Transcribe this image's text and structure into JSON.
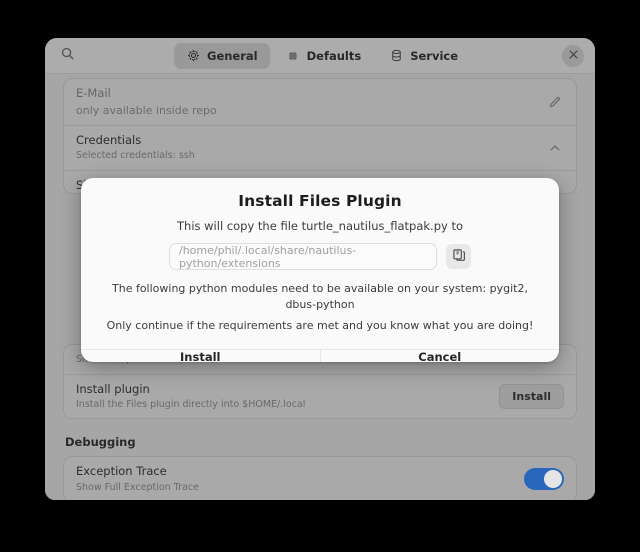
{
  "window": {
    "headerbar": {
      "search_icon": "search-icon",
      "close_icon": "close-icon",
      "tabs": [
        {
          "label": "General",
          "icon": "gear-icon",
          "active": true
        },
        {
          "label": "Defaults",
          "icon": "defaults-icon",
          "active": false
        },
        {
          "label": "Service",
          "icon": "database-icon",
          "active": false
        }
      ]
    },
    "settings": {
      "rows_above": [
        {
          "title": "E-Mail",
          "subtitle": "only available inside repo",
          "action": "edit-icon",
          "dim": true
        },
        {
          "title": "Credentials",
          "subtitle": "Selected credentials: ssh",
          "action": "chevron-up-icon",
          "dim": false
        },
        {
          "title": "Signing",
          "subtitle": "",
          "action": "",
          "dim": false
        }
      ],
      "rows_below": [
        {
          "title": "Show Compare Menu in Files",
          "subtitle": "",
          "action": "",
          "dim": true
        },
        {
          "title": "Install plugin",
          "subtitle": "Install the Files plugin directly into $HOME/.local",
          "action_label": "Install",
          "dim": false
        }
      ],
      "section_debugging": "Debugging",
      "debug_rows": [
        {
          "title": "Exception Trace",
          "subtitle": "Show Full Exception Trace",
          "toggle": "on"
        }
      ]
    }
  },
  "dialog": {
    "title": "Install Files Plugin",
    "subtitle": "This will copy the file turtle_nautilus_flatpak.py to",
    "path_value": "/home/phil/.local/share/nautilus-python/extensions",
    "path_placeholder": "/home/phil/.local/share/nautilus-python/extensions",
    "browse_icon": "folder-open-icon",
    "note_modules": "The following python modules need to be available on your system: pygit2, dbus-python",
    "note_warning": "Only continue if the requirements are met and you know what you are doing!",
    "buttons": [
      {
        "label": "Install"
      },
      {
        "label": "Cancel"
      }
    ]
  },
  "colors": {
    "accent_toggle": "#2a6cc4",
    "window_bg": "#adadad",
    "headerbar_bg": "#b4b4b4",
    "dialog_bg": "#fafafa",
    "backdrop": "#000000"
  }
}
